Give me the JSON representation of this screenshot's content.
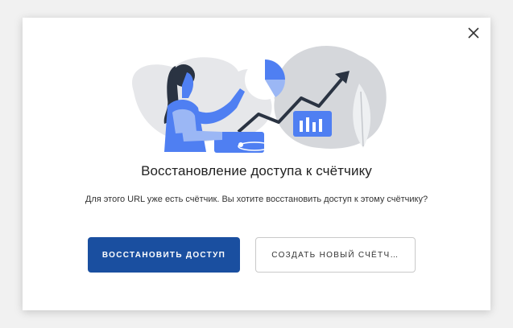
{
  "dialog": {
    "title": "Восстановление доступа к счётчику",
    "message": "Для этого URL уже есть счётчик. Вы хотите восстановить доступ к этому счётчику?",
    "primary_button_label": "ВОССТАНОВИТЬ ДОСТУП",
    "secondary_button_label": "СОЗДАТЬ НОВЫЙ СЧЁТЧ…",
    "close_icon": "close-icon",
    "illustration": "analytics-illustration"
  },
  "colors": {
    "primary": "#1a4fa0",
    "illustration_blue": "#4f7ff2",
    "illustration_light_blue": "#9bb7f5",
    "illustration_grey": "#d5d7db",
    "illustration_dark": "#2a3342"
  }
}
